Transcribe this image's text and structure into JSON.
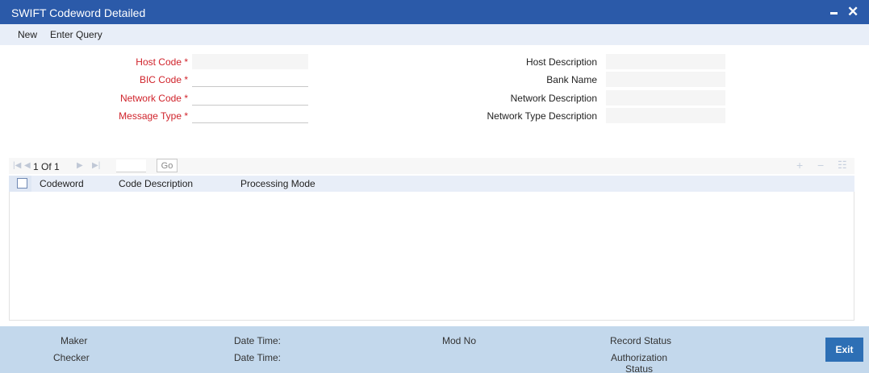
{
  "window": {
    "title": "SWIFT Codeword Detailed"
  },
  "toolbar": {
    "new_label": "New",
    "enter_query_label": "Enter Query"
  },
  "form": {
    "host_code_label": "Host Code *",
    "bic_code_label": "BIC Code *",
    "network_code_label": "Network Code *",
    "message_type_label": "Message Type *",
    "host_description_label": "Host Description",
    "bank_name_label": "Bank Name",
    "network_description_label": "Network Description",
    "network_type_description_label": "Network Type Description",
    "host_code_value": "",
    "bic_code_value": "",
    "network_code_value": "",
    "message_type_value": "",
    "host_description_value": "",
    "bank_name_value": "",
    "network_description_value": "",
    "network_type_description_value": ""
  },
  "grid": {
    "pager_text": "1 Of 1",
    "go_label": "Go",
    "columns": [
      "Codeword",
      "Code Description",
      "Processing Mode"
    ],
    "rows": []
  },
  "footer": {
    "maker_label": "Maker",
    "checker_label": "Checker",
    "date_time_label_1": "Date Time:",
    "date_time_label_2": "Date Time:",
    "mod_no_label": "Mod No",
    "record_status_label": "Record Status",
    "authorization_status_label": "Authorization\nStatus",
    "exit_label": "Exit"
  },
  "colors": {
    "title_bar": "#2b5aa9",
    "required_label": "#d0232b",
    "footer": "#c3d8ec",
    "exit_button": "#2d6fb5"
  }
}
